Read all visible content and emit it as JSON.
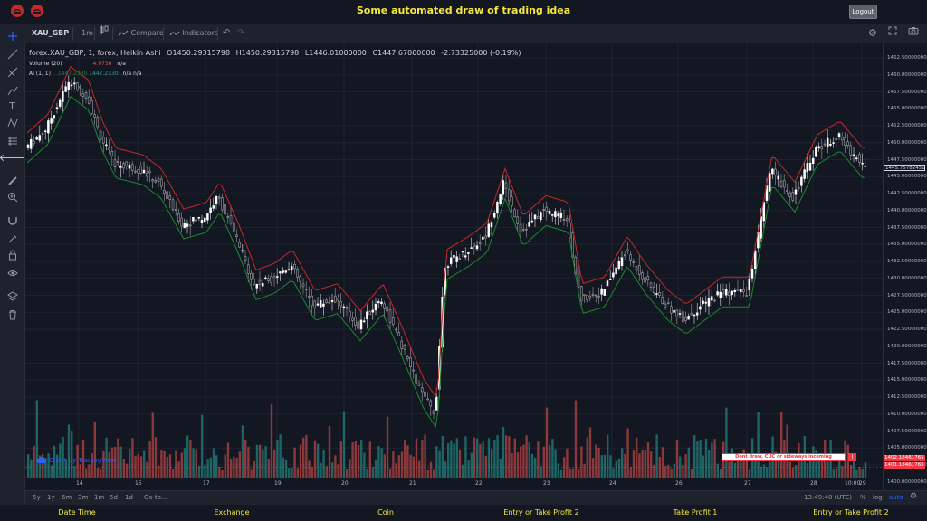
{
  "header": {
    "title": "Some automated draw of trading idea",
    "logout_label": "Logout"
  },
  "toolbar": {
    "symbol": "XAU_GBP",
    "interval": "1m",
    "compare_label": "Compare",
    "indicators_label": "Indicators"
  },
  "legend": {
    "symbol_line": "forex:XAU_GBP, 1, forex, Heikin Ashi",
    "open": "O1450.29315798",
    "high": "H1450.29315798",
    "low": "L1446.01000000",
    "close": "C1447.67000000",
    "change": "-2.73325000 (-0.19%)"
  },
  "volume_legend": {
    "label": "Volume (20)",
    "value": "4.9736",
    "na": "n/a"
  },
  "ai_legend": {
    "label": "AI (1, 1)",
    "v1": "1447.2330",
    "v2": "1447.2330",
    "na1": "n/a",
    "na2": "n/a"
  },
  "price_axis": {
    "ticks": [
      "1462.50000000",
      "1460.00000000",
      "1457.50000000",
      "1455.00000000",
      "1452.50000000",
      "1450.00000000",
      "1447.50000000",
      "1445.00000000",
      "1442.50000000",
      "1440.00000000",
      "1437.50000000",
      "1435.00000000",
      "1432.50000000",
      "1430.00000000",
      "1427.50000000",
      "1425.00000000",
      "1422.50000000",
      "1420.00000000",
      "1417.50000000",
      "1415.00000000",
      "1412.50000000",
      "1410.00000000",
      "1407.50000000",
      "1405.00000000",
      "1402.50000000",
      "1400.00000000"
    ],
    "last_price": "1445.75782450",
    "tag1": "1402.18461765",
    "tag2": "1401.18461765"
  },
  "time_axis": {
    "ticks": [
      "14",
      "15",
      "17",
      "19",
      "20",
      "21",
      "22",
      "23",
      "24",
      "26",
      "27",
      "28",
      "29",
      "10:00"
    ]
  },
  "bottom": {
    "ranges": [
      "5y",
      "1y",
      "6m",
      "3m",
      "1m",
      "5d",
      "1d"
    ],
    "goto": "Go to...",
    "clock": "13:49:40 (UTC)",
    "pct": "%",
    "log": "log",
    "auto": "auto"
  },
  "watermark": "Chart by TradingView",
  "alert": {
    "text": "Dont draw, CUC or sideways incoming",
    "icon": "!"
  },
  "footer": [
    "Date Time",
    "Exchange",
    "Coin",
    "Entry or Take Profit 2",
    "Take Profit 1",
    "Entry or Take Profit 2"
  ],
  "colors": {
    "up": "#26a69a",
    "down": "#ef5350",
    "candle_up": "#ffffff",
    "title": "#f5e642",
    "ai_line_red": "#c62828",
    "ai_line_green": "#1b8a2e"
  }
}
